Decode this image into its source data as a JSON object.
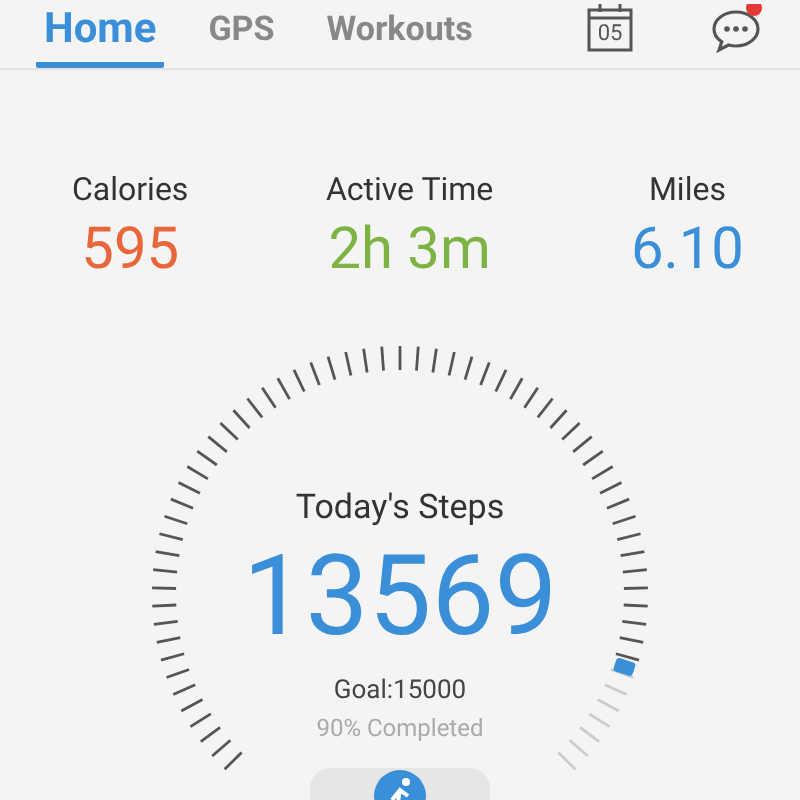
{
  "tabs": [
    {
      "label": "Home",
      "selected": true
    },
    {
      "label": "GPS",
      "selected": false
    },
    {
      "label": "Workouts",
      "selected": false
    }
  ],
  "calendar": {
    "day": "05"
  },
  "messages": {
    "unread": true
  },
  "stats": [
    {
      "label": "Calories",
      "value": "595",
      "color": "#e8663a"
    },
    {
      "label": "Active Time",
      "value": "2h 3m",
      "color": "#7cb342"
    },
    {
      "label": "Miles",
      "value": "6.10",
      "color": "#3a8fd8"
    }
  ],
  "steps": {
    "title": "Today's Steps",
    "count": "13569",
    "goal": "Goal:15000",
    "completed": "90% Completed"
  }
}
